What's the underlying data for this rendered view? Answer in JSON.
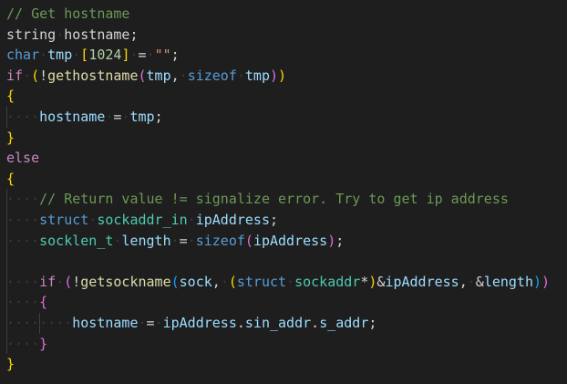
{
  "editor": {
    "colors": {
      "background": "#1e1e1e",
      "plain": "#d4d4d4",
      "comment": "#6a9955",
      "keyword": "#569cd6",
      "control": "#c586c0",
      "type": "#4ec9b0",
      "function": "#dcdcaa",
      "variable": "#9cdcfe",
      "number": "#b5cea8",
      "string": "#ce9178",
      "bracket_gold": "#ffd700",
      "bracket_purple": "#da70d6",
      "bracket_blue": "#179fff",
      "whitespace_marker": "#3b3b3b"
    },
    "lines": [
      {
        "tokens": [
          {
            "t": "// Get hostname",
            "c": "comment"
          }
        ]
      },
      {
        "tokens": [
          {
            "t": "string",
            "c": "plain"
          },
          {
            "t": " ",
            "c": "ws"
          },
          {
            "t": "hostname",
            "c": "plain"
          },
          {
            "t": ";",
            "c": "plain"
          }
        ]
      },
      {
        "tokens": [
          {
            "t": "char",
            "c": "keyword"
          },
          {
            "t": " ",
            "c": "ws"
          },
          {
            "t": "tmp",
            "c": "variable"
          },
          {
            "t": " ",
            "c": "ws"
          },
          {
            "t": "[",
            "c": "bracket_gold"
          },
          {
            "t": "1024",
            "c": "number"
          },
          {
            "t": "]",
            "c": "bracket_gold"
          },
          {
            "t": " ",
            "c": "ws"
          },
          {
            "t": "=",
            "c": "plain"
          },
          {
            "t": " ",
            "c": "ws"
          },
          {
            "t": "\"\"",
            "c": "string"
          },
          {
            "t": ";",
            "c": "plain"
          }
        ]
      },
      {
        "tokens": [
          {
            "t": "if",
            "c": "control"
          },
          {
            "t": " ",
            "c": "ws"
          },
          {
            "t": "(",
            "c": "bracket_gold"
          },
          {
            "t": "!",
            "c": "plain"
          },
          {
            "t": "gethostname",
            "c": "function"
          },
          {
            "t": "(",
            "c": "bracket_purple"
          },
          {
            "t": "tmp",
            "c": "variable"
          },
          {
            "t": ",",
            "c": "plain"
          },
          {
            "t": " ",
            "c": "ws"
          },
          {
            "t": "sizeof",
            "c": "keyword"
          },
          {
            "t": " ",
            "c": "ws"
          },
          {
            "t": "tmp",
            "c": "variable"
          },
          {
            "t": ")",
            "c": "bracket_purple"
          },
          {
            "t": ")",
            "c": "bracket_gold"
          }
        ]
      },
      {
        "tokens": [
          {
            "t": "{",
            "c": "bracket_gold"
          }
        ]
      },
      {
        "guides": [
          0
        ],
        "tokens": [
          {
            "t": "    ",
            "c": "ws"
          },
          {
            "t": "hostname",
            "c": "variable"
          },
          {
            "t": " ",
            "c": "ws"
          },
          {
            "t": "=",
            "c": "plain"
          },
          {
            "t": " ",
            "c": "ws"
          },
          {
            "t": "tmp",
            "c": "variable"
          },
          {
            "t": ";",
            "c": "plain"
          }
        ]
      },
      {
        "tokens": [
          {
            "t": "}",
            "c": "bracket_gold"
          }
        ]
      },
      {
        "tokens": [
          {
            "t": "else",
            "c": "control"
          }
        ]
      },
      {
        "tokens": [
          {
            "t": "{",
            "c": "bracket_gold"
          }
        ]
      },
      {
        "guides": [
          0
        ],
        "tokens": [
          {
            "t": "    ",
            "c": "ws"
          },
          {
            "t": "// Return value != signalize error. Try to get ip address",
            "c": "comment"
          }
        ]
      },
      {
        "guides": [
          0
        ],
        "tokens": [
          {
            "t": "    ",
            "c": "ws"
          },
          {
            "t": "struct",
            "c": "keyword"
          },
          {
            "t": " ",
            "c": "ws"
          },
          {
            "t": "sockaddr_in",
            "c": "type"
          },
          {
            "t": " ",
            "c": "ws"
          },
          {
            "t": "ipAddress",
            "c": "variable"
          },
          {
            "t": ";",
            "c": "plain"
          }
        ]
      },
      {
        "guides": [
          0
        ],
        "tokens": [
          {
            "t": "    ",
            "c": "ws"
          },
          {
            "t": "socklen_t",
            "c": "type"
          },
          {
            "t": " ",
            "c": "ws"
          },
          {
            "t": "length",
            "c": "variable"
          },
          {
            "t": " ",
            "c": "ws"
          },
          {
            "t": "=",
            "c": "plain"
          },
          {
            "t": " ",
            "c": "ws"
          },
          {
            "t": "sizeof",
            "c": "keyword"
          },
          {
            "t": "(",
            "c": "bracket_purple"
          },
          {
            "t": "ipAddress",
            "c": "variable"
          },
          {
            "t": ")",
            "c": "bracket_purple"
          },
          {
            "t": ";",
            "c": "plain"
          }
        ]
      },
      {
        "guides": [
          0
        ],
        "tokens": []
      },
      {
        "guides": [
          0
        ],
        "tokens": [
          {
            "t": "    ",
            "c": "ws"
          },
          {
            "t": "if",
            "c": "control"
          },
          {
            "t": " ",
            "c": "ws"
          },
          {
            "t": "(",
            "c": "bracket_purple"
          },
          {
            "t": "!",
            "c": "plain"
          },
          {
            "t": "getsockname",
            "c": "function"
          },
          {
            "t": "(",
            "c": "bracket_blue"
          },
          {
            "t": "sock",
            "c": "variable"
          },
          {
            "t": ",",
            "c": "plain"
          },
          {
            "t": " ",
            "c": "ws"
          },
          {
            "t": "(",
            "c": "bracket_gold"
          },
          {
            "t": "struct",
            "c": "keyword"
          },
          {
            "t": " ",
            "c": "ws"
          },
          {
            "t": "sockaddr",
            "c": "type"
          },
          {
            "t": "*",
            "c": "plain"
          },
          {
            "t": ")",
            "c": "bracket_gold"
          },
          {
            "t": "&",
            "c": "plain"
          },
          {
            "t": "ipAddress",
            "c": "variable"
          },
          {
            "t": ",",
            "c": "plain"
          },
          {
            "t": " ",
            "c": "ws"
          },
          {
            "t": "&",
            "c": "plain"
          },
          {
            "t": "length",
            "c": "variable"
          },
          {
            "t": ")",
            "c": "bracket_blue"
          },
          {
            "t": ")",
            "c": "bracket_purple"
          }
        ]
      },
      {
        "guides": [
          0
        ],
        "tokens": [
          {
            "t": "    ",
            "c": "ws"
          },
          {
            "t": "{",
            "c": "bracket_purple"
          }
        ]
      },
      {
        "guides": [
          0,
          1
        ],
        "tokens": [
          {
            "t": "        ",
            "c": "ws"
          },
          {
            "t": "hostname",
            "c": "variable"
          },
          {
            "t": " ",
            "c": "ws"
          },
          {
            "t": "=",
            "c": "plain"
          },
          {
            "t": " ",
            "c": "ws"
          },
          {
            "t": "ipAddress",
            "c": "variable"
          },
          {
            "t": ".",
            "c": "plain"
          },
          {
            "t": "sin_addr",
            "c": "variable"
          },
          {
            "t": ".",
            "c": "plain"
          },
          {
            "t": "s_addr",
            "c": "variable"
          },
          {
            "t": ";",
            "c": "plain"
          }
        ]
      },
      {
        "guides": [
          0
        ],
        "tokens": [
          {
            "t": "    ",
            "c": "ws"
          },
          {
            "t": "}",
            "c": "bracket_purple"
          }
        ]
      },
      {
        "tokens": [
          {
            "t": "}",
            "c": "bracket_gold"
          }
        ]
      }
    ]
  }
}
